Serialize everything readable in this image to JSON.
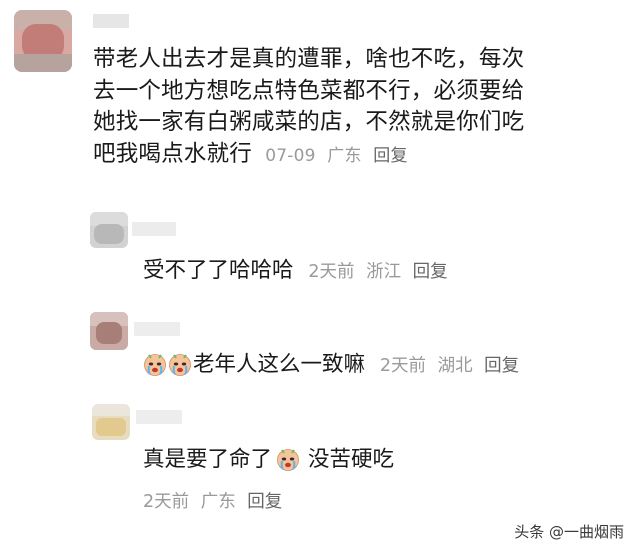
{
  "main_comment": {
    "text_lines": [
      "带老人出去才是真的遭罪，啥也不吃，每次",
      "去一个地方想吃点特色菜都不行，必须要给",
      "她找一家有白粥咸菜的店，不然就是你们吃",
      "吧我喝点水就行"
    ],
    "date": "07-09",
    "location": "广东",
    "reply_label": "回复"
  },
  "replies": [
    {
      "text": "受不了了哈哈哈",
      "time": "2天前",
      "location": "浙江",
      "reply_label": "回复"
    },
    {
      "emojis": [
        "crying-face-icon",
        "crying-face-icon"
      ],
      "text": "老年人这么一致嘛",
      "time": "2天前",
      "location": "湖北",
      "reply_label": "回复"
    },
    {
      "text_before_emoji": "真是要了命了",
      "emoji": "crying-face-icon",
      "text_after_emoji": "没苦硬吃",
      "time": "2天前",
      "location": "广东",
      "reply_label": "回复"
    }
  ],
  "watermark": "头条 @一曲烟雨",
  "colors": {
    "text": "#1a1a1a",
    "meta": "#9a9a9a",
    "reply": "#666666"
  }
}
